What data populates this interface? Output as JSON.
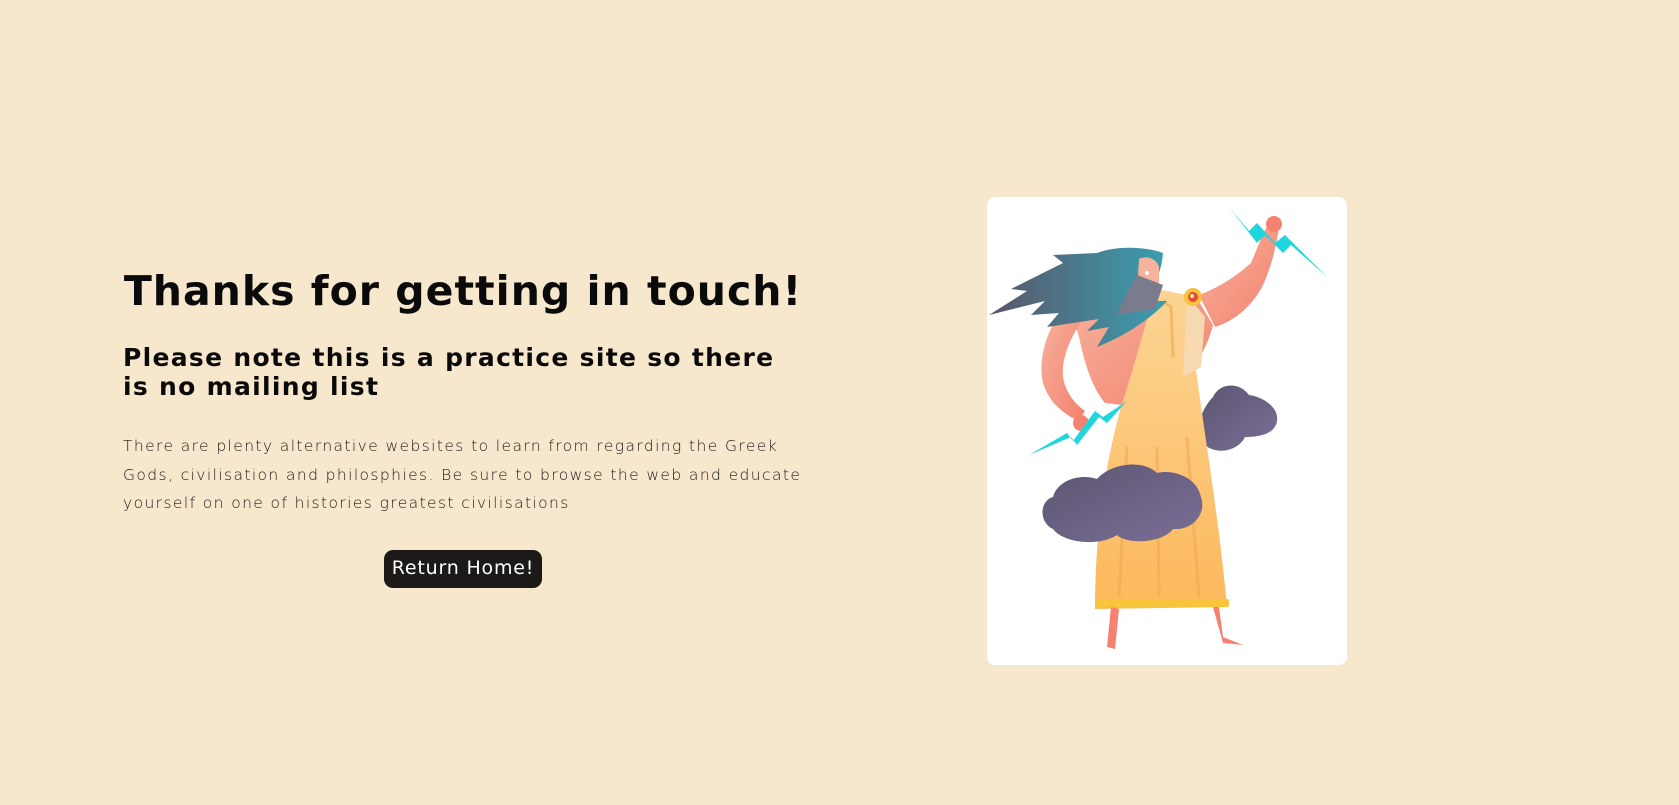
{
  "page": {
    "heading": "Thanks for getting in touch!",
    "subheading": "Please note this is a practice site so there is no mailing list",
    "body": "There are plenty alternative websites to learn from regarding the Greek Gods, civilisation and philosphies. Be sure to browse the web and educate yourself on one of histories greatest civilisations",
    "button_label": "Return Home!"
  },
  "illustration": {
    "subject": "zeus-with-lightning-illustration"
  },
  "colors": {
    "background": "#f6e7cd",
    "button": "#1c1a19",
    "card": "#ffffff",
    "lightning": "#1fd6dc",
    "robe": "#fdc672",
    "skin": "#f7a08a",
    "cloud": "#6e6583",
    "hair": "#3d8fa0"
  }
}
